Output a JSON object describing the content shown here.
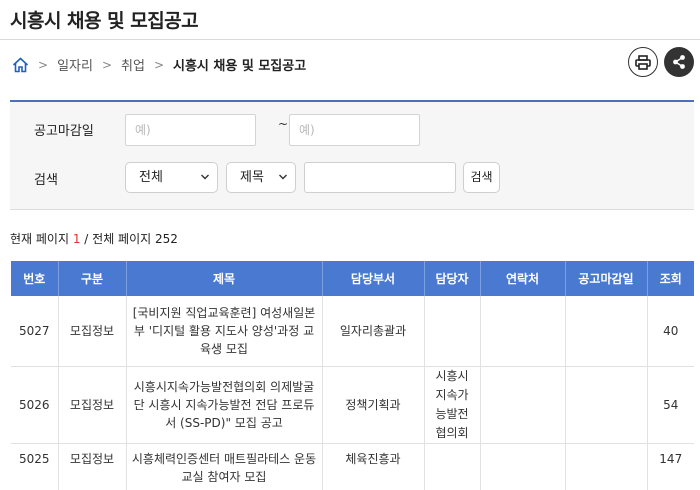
{
  "page": {
    "title": "시흥시 채용 및 모집공고"
  },
  "breadcrumb": {
    "items": [
      "일자리",
      "취업"
    ],
    "current": "시흥시 채용 및 모집공고"
  },
  "icons": {
    "home": "home-icon",
    "print": "print-icon",
    "share": "share-icon"
  },
  "colors": {
    "accent": "#4a79d1",
    "highlight": "#e0322c"
  },
  "search": {
    "date_label": "공고마감일",
    "date_from_placeholder": "예)",
    "date_separator": "~",
    "date_to_placeholder": "예)",
    "keyword_label": "검색",
    "scope_select": "전체",
    "field_select": "제목",
    "keyword_value": "",
    "button": "검색"
  },
  "pagination": {
    "prefix": "현재 페이지 ",
    "current": "1",
    "middle": " / 전체 페이지 ",
    "total": "252"
  },
  "table": {
    "headers": [
      "번호",
      "구분",
      "제목",
      "담당부서",
      "담당자",
      "연락처",
      "공고마감일",
      "조회"
    ],
    "rows": [
      {
        "no": "5027",
        "type": "모집정보",
        "title": "[국비지원 직업교육훈련]          여성새일본부 '디지털 활용 지도사 양성'과정 교육생 모집",
        "dept": "일자리총괄과",
        "manager": "",
        "contact": "",
        "deadline": "",
        "views": "40"
      },
      {
        "no": "5026",
        "type": "모집정보",
        "title": "시흥시지속가능발전협의회 의제발굴단 시흥시 지속가능발전 전담 프로듀서 (SS-PD)\" 모집 공고",
        "dept": "정책기획과",
        "manager": "시흥시지속가능발전협의회",
        "contact": "",
        "deadline": "",
        "views": "54"
      },
      {
        "no": "5025",
        "type": "모집정보",
        "title": "시흥체력인증센터 매트필라테스 운동교실 참여자 모집",
        "dept": "체육진흥과",
        "manager": "",
        "contact": "",
        "deadline": "",
        "views": "147"
      }
    ]
  }
}
